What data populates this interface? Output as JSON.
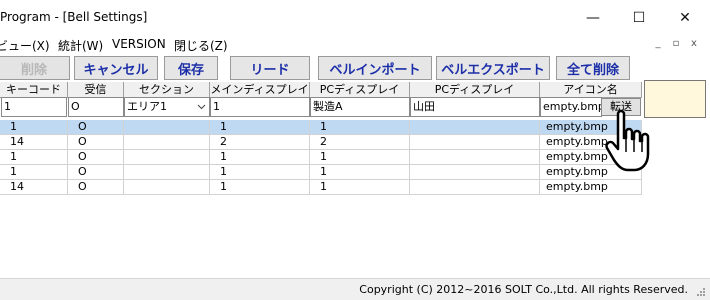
{
  "window": {
    "title": "Program - [Bell Settings]",
    "minimize_glyph": "—",
    "maximize_glyph": "☐",
    "close_glyph": "✕"
  },
  "menu": {
    "items": [
      "ビュー(X)",
      "統計(W)",
      "VERSION",
      "閉じる(Z)"
    ],
    "mdi_minimize": "_",
    "mdi_restore": "▫",
    "mdi_close": "x"
  },
  "toolbar": {
    "delete": "削除",
    "cancel": "キャンセル",
    "save": "保存",
    "read": "リード",
    "bell_import": "ベルインポート",
    "bell_export": "ベルエクスポート",
    "delete_all": "全て削除"
  },
  "columns": [
    "キーコード",
    "受信",
    "セクション",
    "メインディスプレイ",
    "PCディスプレイ",
    "PCディスプレイ",
    "アイコン名"
  ],
  "input_row": {
    "keycode": "1",
    "receive": "O",
    "section": "エリア1",
    "main_display": "1",
    "pc_display_1": "製造A",
    "pc_display_2": "山田",
    "icon_name": "empty.bmp",
    "send_button": "転送"
  },
  "rows": [
    {
      "keycode": "1",
      "receive": "O",
      "section": "",
      "main": "1",
      "pc1": "1",
      "pc2": "",
      "icon": "empty.bmp"
    },
    {
      "keycode": "14",
      "receive": "O",
      "section": "",
      "main": "2",
      "pc1": "2",
      "pc2": "",
      "icon": "empty.bmp"
    },
    {
      "keycode": "1",
      "receive": "O",
      "section": "",
      "main": "1",
      "pc1": "1",
      "pc2": "",
      "icon": "empty.bmp"
    },
    {
      "keycode": "1",
      "receive": "O",
      "section": "",
      "main": "1",
      "pc1": "1",
      "pc2": "",
      "icon": "empty.bmp"
    },
    {
      "keycode": "14",
      "receive": "O",
      "section": "",
      "main": "1",
      "pc1": "1",
      "pc2": "",
      "icon": "empty.bmp"
    }
  ],
  "selected_row_index": 0,
  "status": {
    "copyright": "Copyright (C) 2012~2016 SOLT Co.,Ltd. All rights Reserved."
  },
  "colors": {
    "button_text": "#1c2fa8",
    "selected_row": "#bfd9f3",
    "swatch": "#fff8dc"
  },
  "icons": {
    "cursor": "hand-pointer-icon",
    "dropdown": "chevron-down-icon",
    "resize_grip": "resize-grip-icon"
  }
}
